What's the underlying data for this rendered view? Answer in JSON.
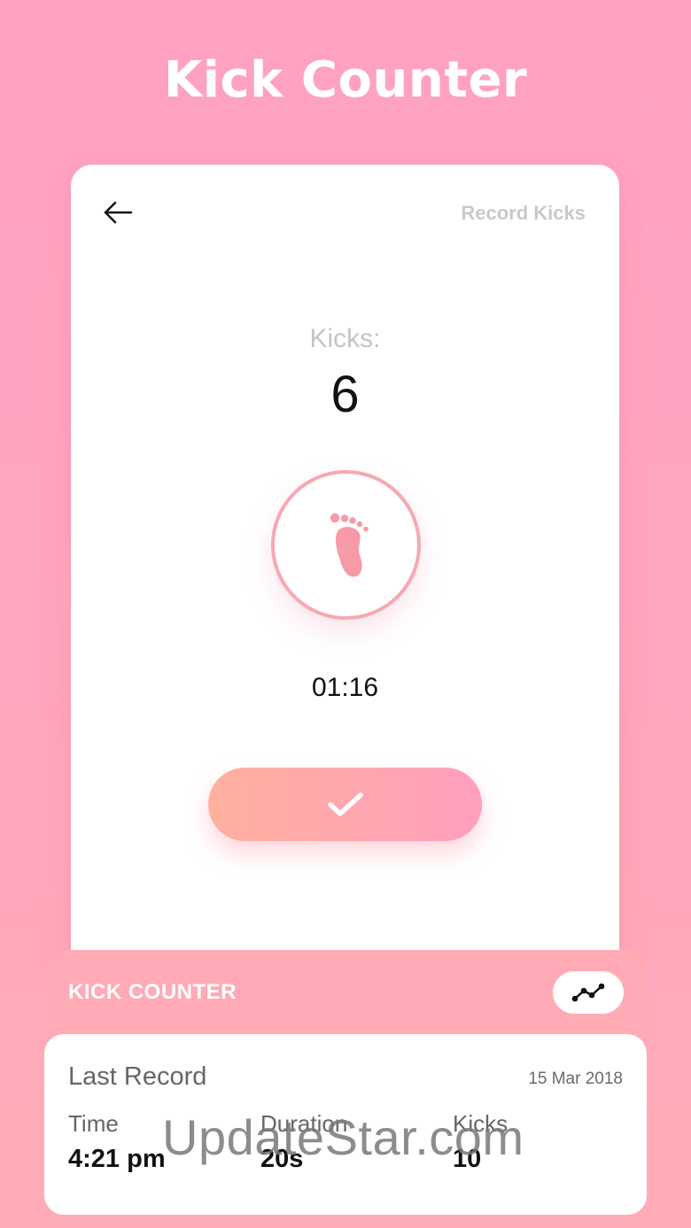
{
  "app": {
    "title": "Kick Counter"
  },
  "card": {
    "header_title": "Record Kicks",
    "kicks_label": "Kicks:",
    "kicks_value": "6",
    "timer": "01:16"
  },
  "icons": {
    "back": "arrow-left-icon",
    "kick": "foot-icon",
    "confirm": "check-icon",
    "chart": "line-chart-icon"
  },
  "colors": {
    "accent_pink": "#ffa2c2",
    "foot_pink": "#f79aa8",
    "button_gradient_start": "#ffb09e",
    "button_gradient_end": "#ff9fbd"
  },
  "panel": {
    "title": "KICK COUNTER",
    "last_record_label": "Last Record",
    "date": "15 Mar 2018",
    "columns": [
      {
        "label": "Time",
        "value": "4:21 pm"
      },
      {
        "label": "Duration",
        "value": "20s"
      },
      {
        "label": "Kicks",
        "value": "10"
      }
    ]
  },
  "watermark": "UpdateStar.com"
}
